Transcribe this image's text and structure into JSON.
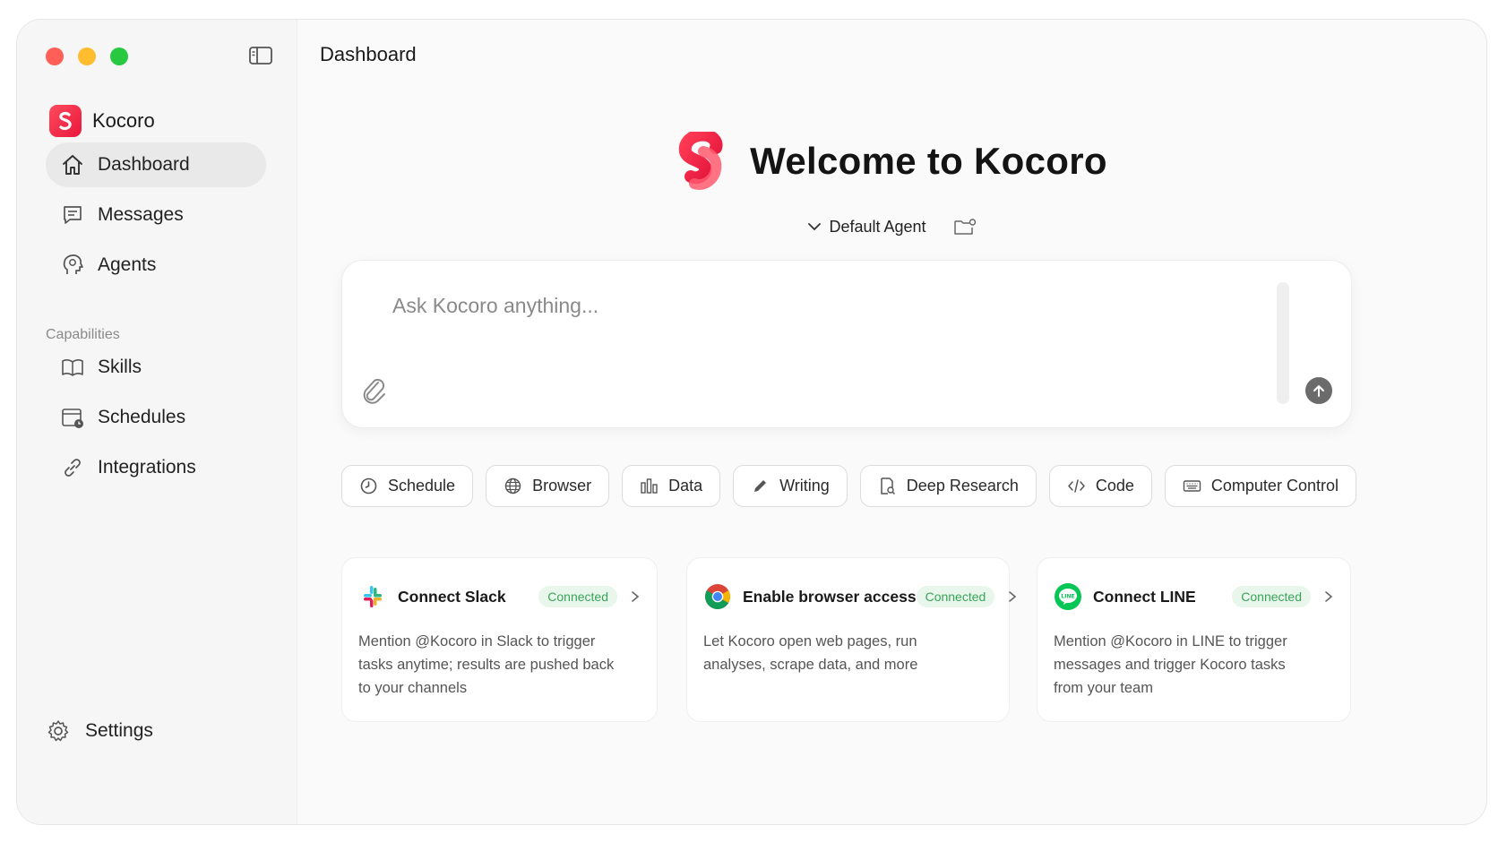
{
  "sidebar": {
    "brand": "Kocoro",
    "nav": [
      {
        "label": "Dashboard",
        "icon": "home-icon"
      },
      {
        "label": "Messages",
        "icon": "chat-icon"
      },
      {
        "label": "Agents",
        "icon": "agent-head-icon"
      }
    ],
    "section_label": "Capabilities",
    "capabilities": [
      {
        "label": "Skills",
        "icon": "book-icon"
      },
      {
        "label": "Schedules",
        "icon": "calendar-clock-icon"
      },
      {
        "label": "Integrations",
        "icon": "link-icon"
      }
    ],
    "settings_label": "Settings"
  },
  "main": {
    "page_title": "Dashboard",
    "welcome_title": "Welcome to Kocoro",
    "agent_label": "Default Agent",
    "prompt_placeholder": "Ask Kocoro anything...",
    "chips": [
      {
        "label": "Schedule",
        "icon": "clock-icon"
      },
      {
        "label": "Browser",
        "icon": "globe-icon"
      },
      {
        "label": "Data",
        "icon": "bar-chart-icon"
      },
      {
        "label": "Writing",
        "icon": "pencil-icon"
      },
      {
        "label": "Deep Research",
        "icon": "document-search-icon"
      },
      {
        "label": "Code",
        "icon": "code-icon"
      },
      {
        "label": "Computer Control",
        "icon": "keyboard-icon"
      }
    ],
    "cards": [
      {
        "title": "Connect Slack",
        "status": "Connected",
        "description": "Mention @Kocoro in Slack to trigger tasks anytime; results are pushed back to your channels",
        "icon": "slack-icon"
      },
      {
        "title": "Enable browser access",
        "status": "Connected",
        "description": "Let Kocoro open web pages, run analyses, scrape data, and more",
        "icon": "chrome-icon"
      },
      {
        "title": "Connect LINE",
        "status": "Connected",
        "description": "Mention @Kocoro in LINE to trigger messages and trigger Kocoro tasks from your team",
        "icon": "line-icon"
      }
    ]
  },
  "colors": {
    "accent": "#e8173d",
    "connected_bg": "#e8f6ec",
    "connected_text": "#3aa35a"
  }
}
